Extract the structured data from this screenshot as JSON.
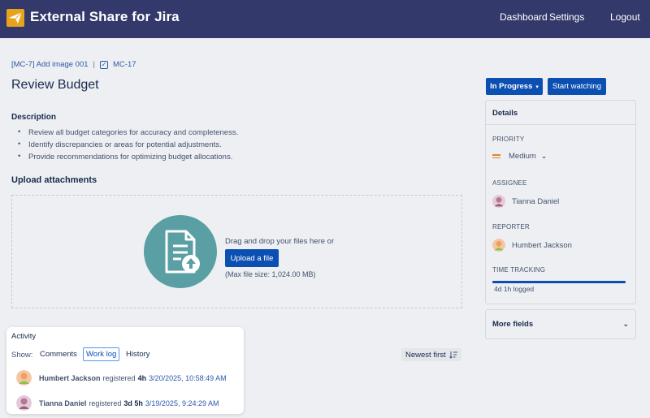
{
  "header": {
    "app_title": "External Share for Jira",
    "nav": {
      "dashboard": "Dashboard",
      "settings": "Settings",
      "logout": "Logout"
    },
    "bg_color": "#33396b"
  },
  "breadcrumb": {
    "parent": "[MC-7] Add image 001",
    "current": "MC-17"
  },
  "issue": {
    "title": "Review Budget",
    "description_label": "Description",
    "description_items": [
      "Review all budget categories for accuracy and completeness.",
      "Identify discrepancies or areas for potential adjustments.",
      "Provide recommendations for optimizing budget allocations."
    ]
  },
  "upload": {
    "title": "Upload attachments",
    "drop_text": "Drag and drop your files here or",
    "button_label": "Upload a file",
    "max_size": "(Max file size: 1,024.00 MB)"
  },
  "activity": {
    "label": "Activity",
    "show_label": "Show:",
    "tabs": [
      "Comments",
      "Work log",
      "History"
    ],
    "active_tab": "Work log",
    "sort_label": "Newest first",
    "entries": [
      {
        "name": "Humbert Jackson",
        "action": "registered",
        "duration": "4h",
        "timestamp": "3/20/2025, 10:58:49 AM"
      },
      {
        "name": "Tianna Daniel",
        "action": "registered",
        "duration": "3d 5h",
        "timestamp": "3/19/2025, 9:24:29 AM"
      }
    ]
  },
  "sidebar": {
    "status_label": "In Progress",
    "watch_label": "Start watching",
    "details_title": "Details",
    "priority_label": "PRIORITY",
    "priority_value": "Medium",
    "assignee_label": "ASSIGNEE",
    "assignee_value": "Tianna Daniel",
    "reporter_label": "REPORTER",
    "reporter_value": "Humbert Jackson",
    "time_tracking_label": "TIME TRACKING",
    "time_logged": "4d 1h logged",
    "time_progress": 1.0,
    "more_fields_label": "More fields"
  },
  "colors": {
    "primary_button": "#0b4fb2",
    "priority_medium": "#e2832a",
    "upload_circle": "#5a9fa3"
  }
}
